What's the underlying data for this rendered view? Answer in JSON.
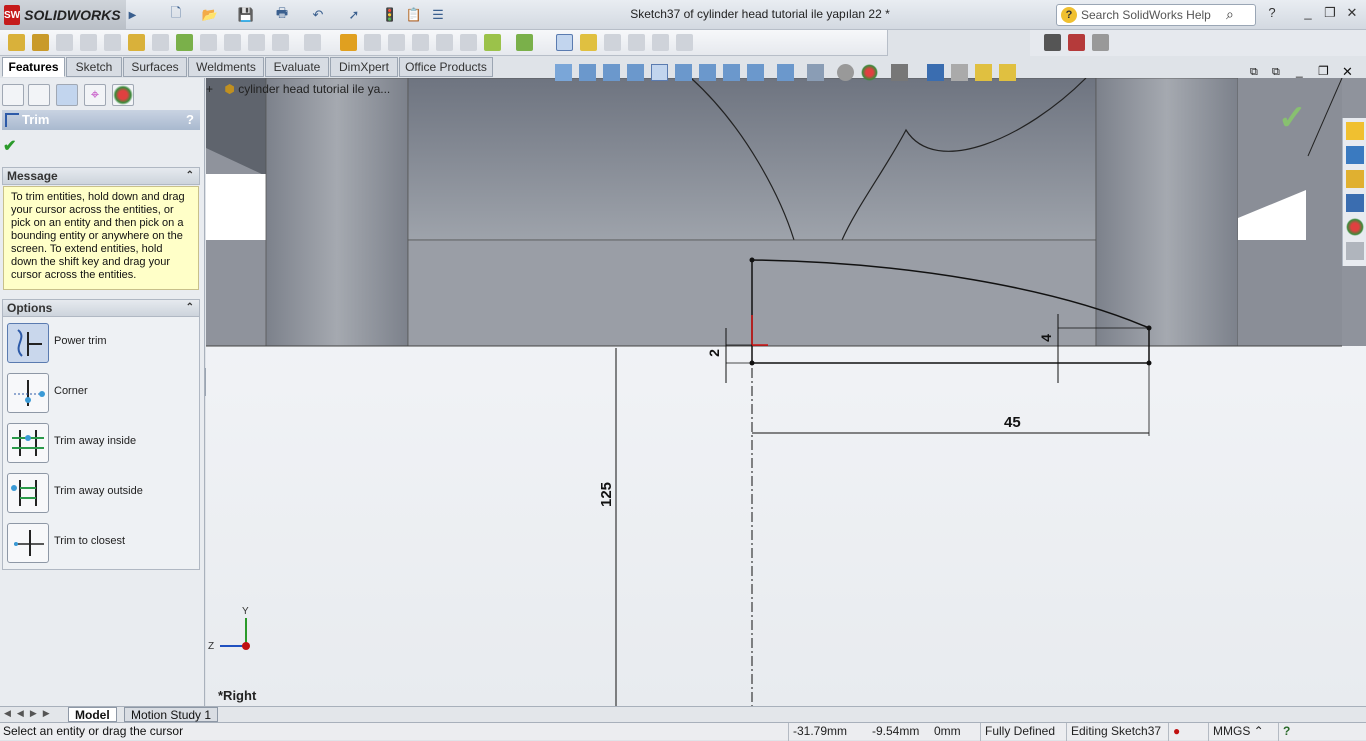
{
  "app": {
    "name": "SOLIDWORKS",
    "badge": "SW"
  },
  "window": {
    "title": "Sketch37 of cylinder head tutorial ile yapılan 22 *"
  },
  "search": {
    "placeholder": "Search SolidWorks Help"
  },
  "tabs": [
    {
      "label": "Features",
      "active": true
    },
    {
      "label": "Sketch"
    },
    {
      "label": "Surfaces"
    },
    {
      "label": "Weldments"
    },
    {
      "label": "Evaluate"
    },
    {
      "label": "DimXpert"
    },
    {
      "label": "Office Products"
    }
  ],
  "property_manager": {
    "title": "Trim",
    "help": "?",
    "message_header": "Message",
    "message": "To trim entities, hold down and drag your cursor across the entities, or pick on an entity and then pick on a bounding entity or anywhere on the screen.  To extend entities, hold down the shift key and drag your cursor across the entities.",
    "options_header": "Options",
    "options": [
      {
        "label": "Power trim",
        "selected": true
      },
      {
        "label": "Corner"
      },
      {
        "label": "Trim away inside"
      },
      {
        "label": "Trim away outside"
      },
      {
        "label": "Trim to closest"
      }
    ]
  },
  "tree": {
    "root": "cylinder head tutorial ile ya..."
  },
  "viewport": {
    "view_name": "*Right",
    "dimensions": {
      "d45": "45",
      "d125": "125",
      "d2": "2",
      "d4": "4"
    },
    "triad": {
      "y": "Y",
      "z": "Z"
    }
  },
  "bottom_tabs": [
    {
      "label": "Model",
      "active": true
    },
    {
      "label": "Motion Study 1"
    }
  ],
  "status": {
    "message": "Select an entity or drag the cursor",
    "x": "-31.79mm",
    "y": "-9.54mm",
    "z": "0mm",
    "state": "Fully Defined",
    "editing": "Editing Sketch37",
    "units": "MMGS"
  },
  "colors": {
    "accent": "#2d5aa8",
    "model": "#8f939c",
    "message_bg": "#ffffc8",
    "ok": "#2a9a2a"
  }
}
